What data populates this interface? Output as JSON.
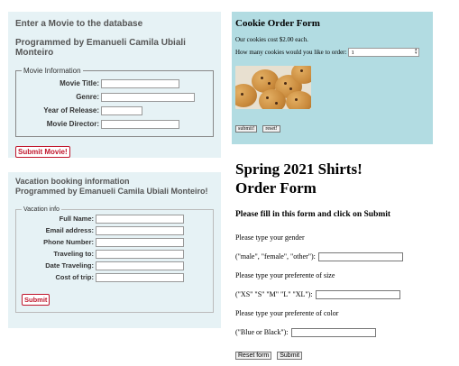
{
  "movie": {
    "heading": "Enter a Movie to the database",
    "subheading": "Programmed by Emanueli Camila Ubiali Monteiro",
    "legend": "Movie Information",
    "fields": [
      {
        "label": "Movie Title:"
      },
      {
        "label": "Genre:"
      },
      {
        "label": "Year of Release:"
      },
      {
        "label": "Movie Director:"
      }
    ],
    "submit": "Submit Movie!"
  },
  "cookie": {
    "title": "Cookie Order Form",
    "price_text": "Our cookies cost $2.00 each.",
    "qty_label": "How many cookies would you like to order:",
    "qty_value": "1",
    "submit": "submit!",
    "reset": "reset!"
  },
  "vacation": {
    "heading1": "Vacation booking information",
    "heading2": "Programmed by Emanueli Camila Ubiali Monteiro!",
    "legend": "Vacation info",
    "fields": [
      {
        "label": "Full Name:"
      },
      {
        "label": "Email address:"
      },
      {
        "label": "Phone Number:"
      },
      {
        "label": "Traveling to:"
      },
      {
        "label": "Date Traveling:"
      },
      {
        "label": "Cost of trip:"
      }
    ],
    "submit": "Submit"
  },
  "shirts": {
    "title1": "Spring 2021 Shirts!",
    "title2": "Order Form",
    "instruction": "Please fill in this form and click on Submit",
    "gender_prompt": "Please type your gender",
    "gender_label": "(\"male\", \"female\", \"other\"):",
    "size_prompt": "Please type your preferente of size",
    "size_label": "(\"XS\" \"S\" \"M\" \"L\" \"XL\"):",
    "color_prompt": "Please type your preferente of color",
    "color_label": "(\"Blue or Black\"):",
    "reset": "Reset form",
    "submit": "Submit"
  }
}
